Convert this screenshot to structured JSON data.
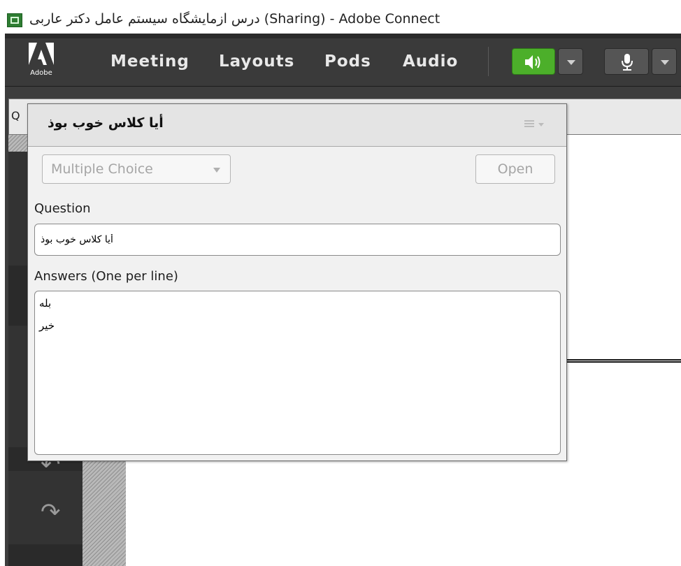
{
  "window": {
    "title": "درس ازمایشگاه سیستم عامل دکتر عاربی (Sharing) - Adobe Connect"
  },
  "menubar": {
    "logo_text": "Adobe",
    "items": [
      "Meeting",
      "Layouts",
      "Pods",
      "Audio"
    ]
  },
  "audio_controls": {
    "speaker_state": "on",
    "speaker_color": "#4caf2a",
    "mic_state": "off"
  },
  "pod_strip": {
    "edge_letter": "Q"
  },
  "poll": {
    "title": "أیا كلاس خوب بوذ",
    "type_selected": "Multiple Choice",
    "open_label": "Open",
    "question_label": "Question",
    "question_value": "أیا كلاس خوب بوذ",
    "answers_label": "Answers (One per line)",
    "answers": [
      "بله",
      "خیر"
    ]
  },
  "toolbar_icons": [
    "undo-icon",
    "redo-icon"
  ]
}
